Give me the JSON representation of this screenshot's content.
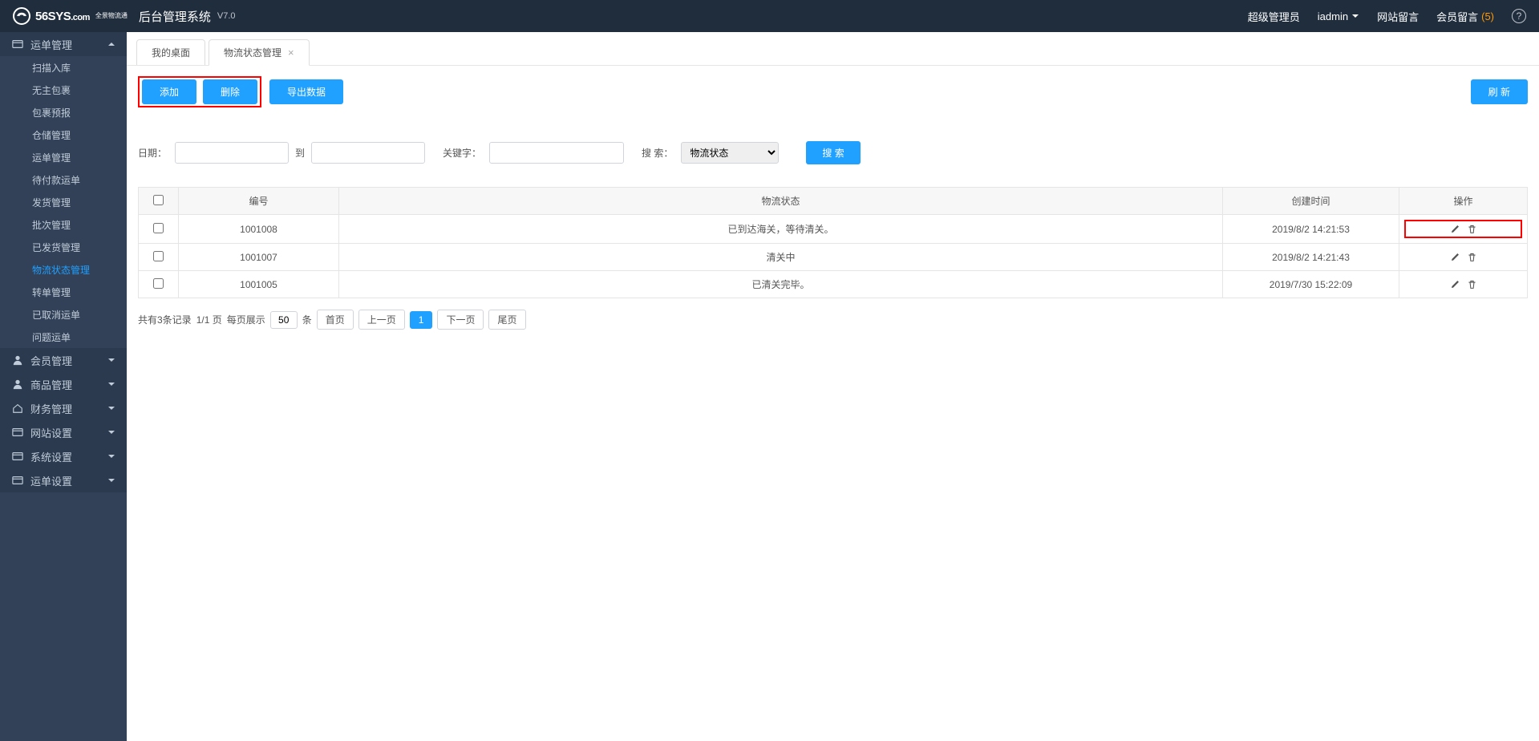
{
  "header": {
    "logo_main": "56SYS",
    "logo_domain": ".com",
    "logo_sub1": "全景物流通",
    "sys_title": "后台管理系统",
    "version": "V7.0",
    "right": {
      "role": "超级管理员",
      "user": "iadmin",
      "site_msg": "网站留言",
      "member_msg": "会员留言",
      "member_msg_count": "(5)"
    }
  },
  "sidebar": {
    "groups": [
      {
        "label": "运单管理",
        "expanded": true,
        "items": [
          "扫描入库",
          "无主包裹",
          "包裹预报",
          "仓储管理",
          "运单管理",
          "待付款运单",
          "发货管理",
          "批次管理",
          "已发货管理",
          "物流状态管理",
          "转单管理",
          "已取消运单",
          "问题运单"
        ],
        "active_index": 9
      },
      {
        "label": "会员管理",
        "expanded": false
      },
      {
        "label": "商品管理",
        "expanded": false
      },
      {
        "label": "财务管理",
        "expanded": false
      },
      {
        "label": "网站设置",
        "expanded": false
      },
      {
        "label": "系统设置",
        "expanded": false
      },
      {
        "label": "运单设置",
        "expanded": false
      }
    ]
  },
  "tabs": {
    "items": [
      {
        "label": "我的桌面",
        "closable": false
      },
      {
        "label": "物流状态管理",
        "closable": true
      }
    ],
    "active": 1
  },
  "toolbar": {
    "add": "添加",
    "delete": "删除",
    "export": "导出数据",
    "refresh": "刷 新"
  },
  "filters": {
    "date_label": "日期：",
    "to": "到",
    "keyword_label": "关键字：",
    "search_label": "搜 索：",
    "search_btn": "搜 索",
    "select_value": "物流状态"
  },
  "table": {
    "cols": [
      "",
      "编号",
      "物流状态",
      "创建时间",
      "操作"
    ],
    "rows": [
      {
        "id": "1001008",
        "status": "已到达海关，等待清关。",
        "time": "2019/8/2 14:21:53",
        "highlight": true
      },
      {
        "id": "1001007",
        "status": "清关中",
        "time": "2019/8/2 14:21:43",
        "highlight": false
      },
      {
        "id": "1001005",
        "status": "已清关完毕。",
        "time": "2019/7/30 15:22:09",
        "highlight": false
      }
    ]
  },
  "pager": {
    "total_text": "共有3条记录",
    "page_text": "1/1 页",
    "perpage_label": "每页展示",
    "perpage_value": "50",
    "unit": "条",
    "first": "首页",
    "prev": "上一页",
    "current": "1",
    "next": "下一页",
    "last": "尾页"
  }
}
